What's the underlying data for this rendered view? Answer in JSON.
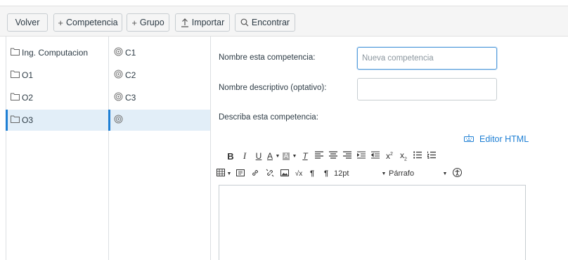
{
  "toolbar": {
    "volver": "Volver",
    "competencia": "Competencia",
    "grupo": "Grupo",
    "importar": "Importar",
    "encontrar": "Encontrar"
  },
  "groups": [
    {
      "label": "Ing. Computacion"
    },
    {
      "label": "O1"
    },
    {
      "label": "O2"
    },
    {
      "label": "O3"
    }
  ],
  "competencias": [
    {
      "label": "C1"
    },
    {
      "label": "C2"
    },
    {
      "label": "C3"
    },
    {
      "label": ""
    }
  ],
  "form": {
    "nombre_label": "Nombre esta competencia:",
    "nombre_placeholder": "Nueva competencia",
    "descriptivo_label": "Nombre descriptivo (optativo):",
    "describa_label": "Describa esta competencia:",
    "editor_html": "Editor HTML"
  },
  "editor": {
    "font_size": "12pt",
    "paragraph": "Párrafo"
  },
  "colors": {
    "accent": "#1e7fd4",
    "selected_row": "#e2eef8"
  }
}
